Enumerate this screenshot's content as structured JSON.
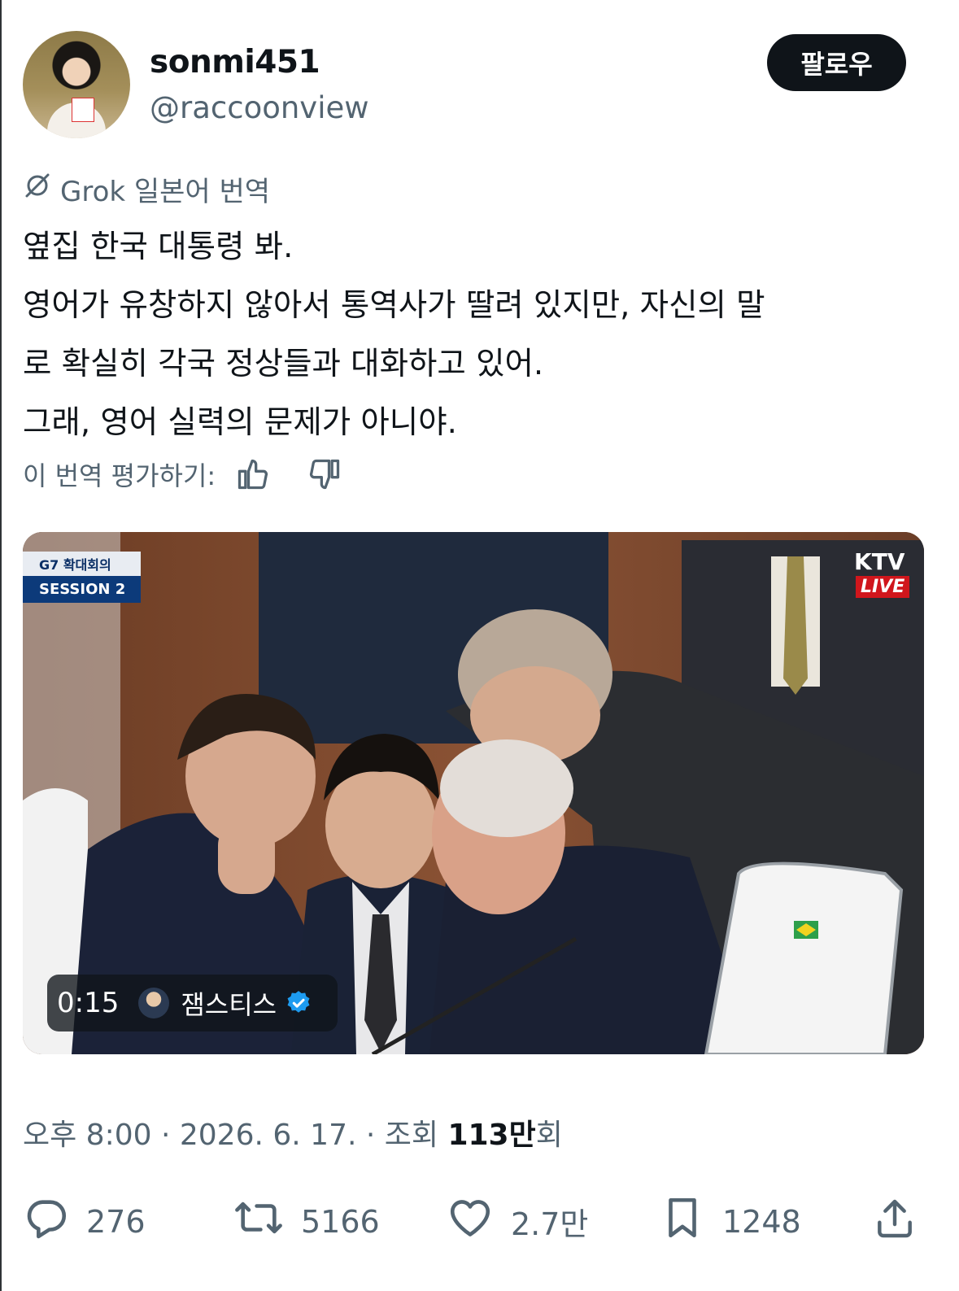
{
  "author": {
    "display_name": "sonmi451",
    "handle": "@raccoonview",
    "avatar_icon": "profile-avatar"
  },
  "follow_button": {
    "label": "팔로우"
  },
  "translation": {
    "label": "Grok 일본어 번역",
    "icon": "grok-icon"
  },
  "tweet": {
    "lines": [
      "옆집 한국 대통령 봐.",
      "영어가 유창하지 않아서 통역사가 딸려 있지만, 자신의 말",
      "로 확실히 각국 정상들과 대화하고 있어.",
      "그래, 영어 실력의 문제가 아니야."
    ]
  },
  "rate_translation": {
    "label": "이 번역 평가하기:",
    "up_icon": "thumbs-up-icon",
    "down_icon": "thumbs-down-icon"
  },
  "media": {
    "g7_line1": "G7 확대회의",
    "g7_line2": "SESSION 2",
    "channel": "KTV",
    "live": "LIVE",
    "duration": "0:15",
    "source_name": "잼스티스",
    "source_verified": true
  },
  "meta": {
    "time": "오후 8:00",
    "sep1": " · ",
    "date": "2026. 6. 17.",
    "sep2": " · ",
    "views_label": "조회 ",
    "views_count": "113만",
    "views_suffix": "회"
  },
  "actions": {
    "replies": "276",
    "reposts": "5166",
    "likes": "2.7만",
    "bookmarks": "1248"
  },
  "colors": {
    "text": "#0f1419",
    "secondary": "#536471",
    "verified": "#1d9bf0",
    "live_red": "#d0161c"
  }
}
